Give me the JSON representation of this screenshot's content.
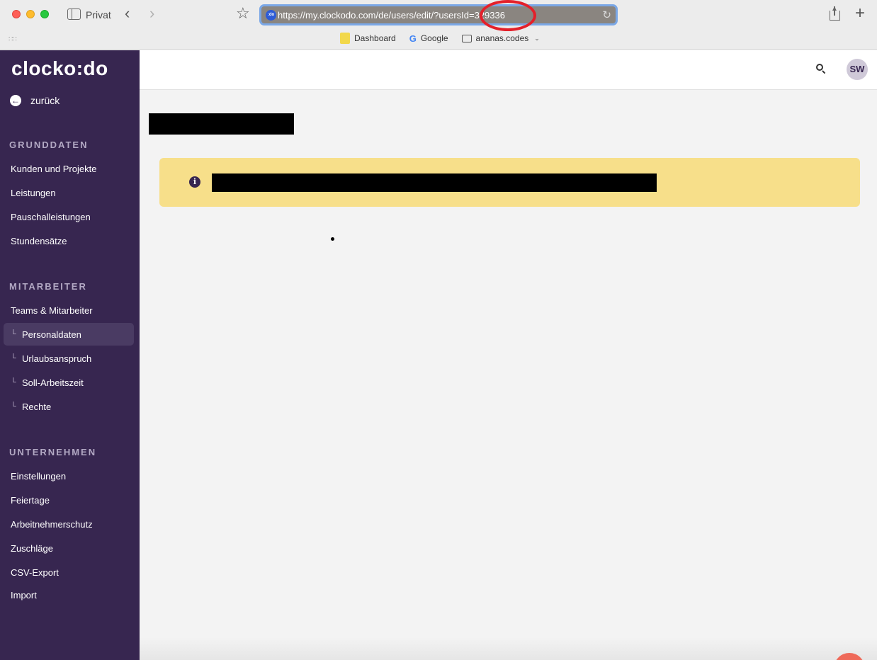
{
  "browser": {
    "privacy_label": "Privat",
    "url": "https://my.clockodo.com/de/users/edit/?usersId=329336",
    "favicon_text": ":do",
    "bookmarks": [
      {
        "label": "Dashboard"
      },
      {
        "label": "Google"
      },
      {
        "label": "ananas.codes"
      }
    ],
    "highlight_color": "#e4202a"
  },
  "app": {
    "logo": "clocko:do",
    "back_label": "zurück",
    "avatar_initials": "SW",
    "brand_color": "#372650",
    "notice_color": "#f7df8a"
  },
  "sidebar": {
    "sections": [
      {
        "title": "GRUNDDATEN",
        "items": [
          "Kunden und Projekte",
          "Leistungen",
          "Pauschalleistungen",
          "Stundensätze"
        ]
      },
      {
        "title": "MITARBEITER",
        "items": [
          "Teams & Mitarbeiter"
        ],
        "subitems": [
          {
            "label": "Personaldaten",
            "active": true
          },
          {
            "label": "Urlaubsanspruch",
            "active": false
          },
          {
            "label": "Soll-Arbeitszeit",
            "active": false
          },
          {
            "label": "Rechte",
            "active": false
          }
        ]
      },
      {
        "title": "UNTERNEHMEN",
        "items": [
          "Einstellungen",
          "Feiertage",
          "Arbeitnehmerschutz",
          "Zuschläge",
          "CSV-Export",
          "Import"
        ]
      }
    ]
  }
}
